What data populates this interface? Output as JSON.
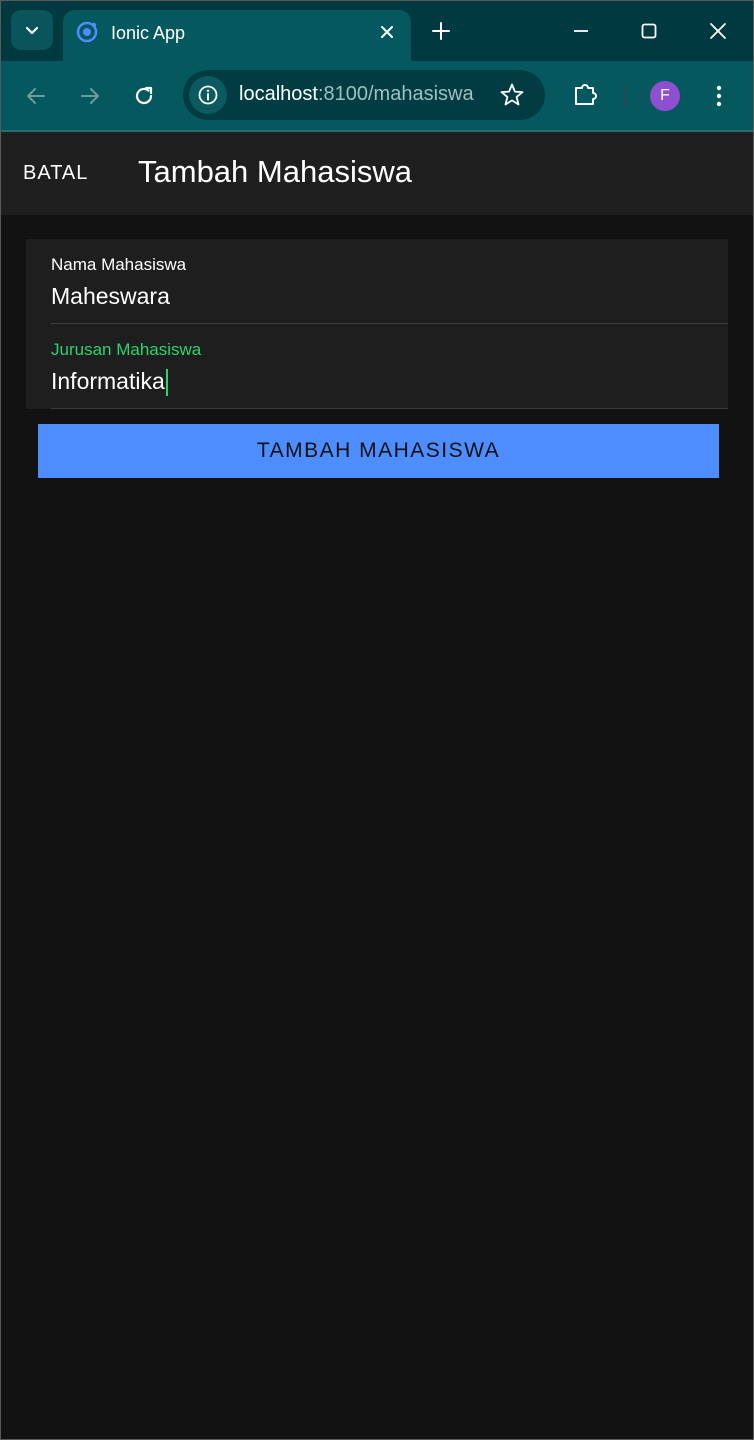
{
  "browser": {
    "tab_title": "Ionic App",
    "url_host": "localhost",
    "url_path": ":8100/mahasiswa",
    "profile_initial": "F"
  },
  "header": {
    "cancel_label": "BATAL",
    "title": "Tambah Mahasiswa"
  },
  "form": {
    "name_label": "Nama Mahasiswa",
    "name_value": "Maheswara",
    "major_label": "Jurusan Mahasiswa",
    "major_value": "Informatika",
    "submit_label": "TAMBAH MAHASISWA"
  },
  "colors": {
    "browser_frame": "#003a40",
    "toolbar": "#06585f",
    "background": "#121212",
    "header": "#1f1f1f",
    "focus_accent": "#2dd36f",
    "primary_button": "#4d8dff",
    "avatar": "#8e4fd1"
  },
  "icons": {
    "tab_search": "chevron-down-icon",
    "favicon": "ionic-logo-icon",
    "tab_close": "close-icon",
    "new_tab": "plus-icon",
    "minimize": "minimize-icon",
    "maximize": "maximize-icon",
    "close_window": "close-icon",
    "back": "arrow-left-icon",
    "forward": "arrow-right-icon",
    "reload": "reload-icon",
    "site_info": "info-icon",
    "bookmark": "star-icon",
    "extensions": "puzzle-icon",
    "menu": "kebab-menu-icon"
  }
}
